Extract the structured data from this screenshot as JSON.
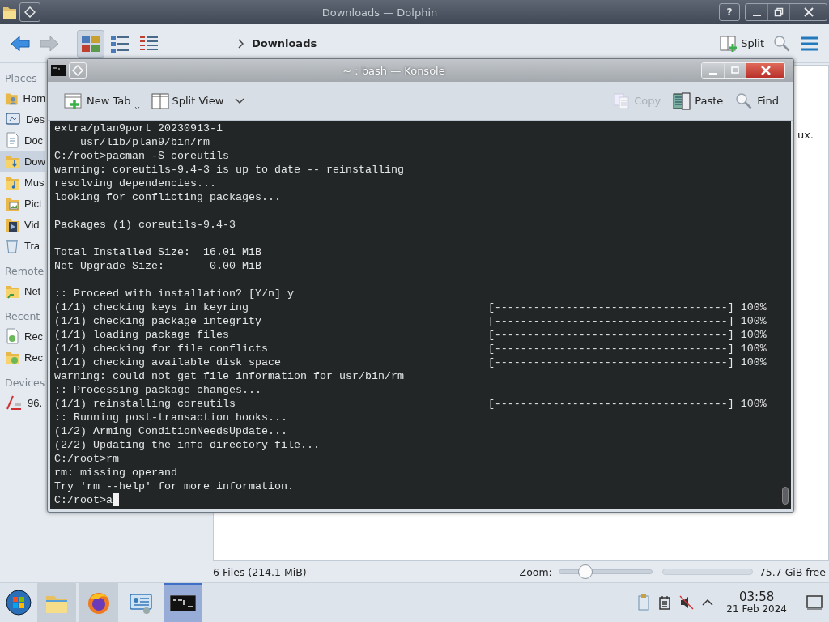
{
  "dolphin": {
    "title": "Downloads — Dolphin",
    "help_button": "?",
    "toolbar": {
      "back": {
        "disabled": false
      },
      "forward": {
        "disabled": true
      },
      "view_modes": [
        {
          "selected": true
        },
        {
          "selected": false
        },
        {
          "selected": false
        }
      ],
      "breadcrumb": "Downloads",
      "split_button": "Split"
    },
    "sidebar": {
      "sections": [
        {
          "title": "Places",
          "items": [
            {
              "label": "Hom",
              "selected": false
            },
            {
              "label": "Des",
              "selected": false
            },
            {
              "label": "Doc",
              "selected": false
            },
            {
              "label": "Dow",
              "selected": true
            },
            {
              "label": "Mus",
              "selected": false
            },
            {
              "label": "Pict",
              "selected": false
            },
            {
              "label": "Vid",
              "selected": false
            },
            {
              "label": "Tra",
              "selected": false
            }
          ]
        },
        {
          "title": "Remote",
          "items": [
            {
              "label": "Net",
              "selected": false
            }
          ]
        },
        {
          "title": "Recent",
          "items": [
            {
              "label": "Rec",
              "selected": false
            },
            {
              "label": "Rec",
              "selected": false
            }
          ]
        },
        {
          "title": "Devices",
          "items": [
            {
              "label": "96.",
              "selected": false
            }
          ]
        }
      ]
    },
    "content_text": "ux.",
    "status_bar": {
      "summary": "6 Files (214.1 MiB)",
      "zoom_label": "Zoom:",
      "zoom_slider": {
        "level": 0.29
      },
      "free_space": "75.7 GiB free"
    }
  },
  "konsole": {
    "title": "~ : bash — Konsole",
    "toolbar": [
      {
        "label": "New Tab",
        "disabled": false
      },
      {
        "label": "Split View",
        "disabled": false
      },
      {
        "label": "Copy",
        "disabled": true
      },
      {
        "label": "Paste",
        "disabled": false
      },
      {
        "label": "Find",
        "disabled": false
      }
    ],
    "lines": [
      {
        "kind": "output",
        "text": "extra/plan9port 20230913-1"
      },
      {
        "kind": "output",
        "text": "    usr/lib/plan9/bin/rm"
      },
      {
        "kind": "output",
        "text": "C:/root>pacman -S coreutils"
      },
      {
        "kind": "output",
        "text": "warning: coreutils-9.4-3 is up to date -- reinstalling"
      },
      {
        "kind": "output",
        "text": "resolving dependencies..."
      },
      {
        "kind": "output",
        "text": "looking for conflicting packages..."
      },
      {
        "kind": "blank"
      },
      {
        "kind": "output",
        "text": "Packages (1) coreutils-9.4-3"
      },
      {
        "kind": "blank"
      },
      {
        "kind": "output",
        "text": "Total Installed Size:  16.01 MiB"
      },
      {
        "kind": "output",
        "text": "Net Upgrade Size:       0.00 MiB"
      },
      {
        "kind": "blank"
      },
      {
        "kind": "output",
        "text": ":: Proceed with installation? [Y/n] y"
      },
      {
        "kind": "progress",
        "text": "(1/1) checking keys in keyring",
        "bar": "[------------------------------------]",
        "percent": "100%"
      },
      {
        "kind": "progress",
        "text": "(1/1) checking package integrity",
        "bar": "[------------------------------------]",
        "percent": "100%"
      },
      {
        "kind": "progress",
        "text": "(1/1) loading package files",
        "bar": "[------------------------------------]",
        "percent": "100%"
      },
      {
        "kind": "progress",
        "text": "(1/1) checking for file conflicts",
        "bar": "[------------------------------------]",
        "percent": "100%"
      },
      {
        "kind": "progress",
        "text": "(1/1) checking available disk space",
        "bar": "[------------------------------------]",
        "percent": "100%"
      },
      {
        "kind": "output",
        "text": "warning: could not get file information for usr/bin/rm"
      },
      {
        "kind": "output",
        "text": ":: Processing package changes..."
      },
      {
        "kind": "progress",
        "text": "(1/1) reinstalling coreutils",
        "bar": "[------------------------------------]",
        "percent": "100%"
      },
      {
        "kind": "output",
        "text": ":: Running post-transaction hooks..."
      },
      {
        "kind": "output",
        "text": "(1/2) Arming ConditionNeedsUpdate..."
      },
      {
        "kind": "output",
        "text": "(2/2) Updating the info directory file..."
      },
      {
        "kind": "output",
        "text": "C:/root>rm"
      },
      {
        "kind": "output",
        "text": "rm: missing operand"
      },
      {
        "kind": "output",
        "text": "Try 'rm --help' for more information."
      },
      {
        "kind": "input",
        "text": "C:/root>a"
      }
    ]
  },
  "taskbar": {
    "tasks": [
      {
        "open": true,
        "selected": false
      },
      {
        "open": true,
        "selected": false
      },
      {
        "open": false,
        "selected": false
      },
      {
        "open": true,
        "selected": true
      }
    ],
    "clock": {
      "time": "03:58",
      "date": "21 Feb 2024"
    }
  }
}
